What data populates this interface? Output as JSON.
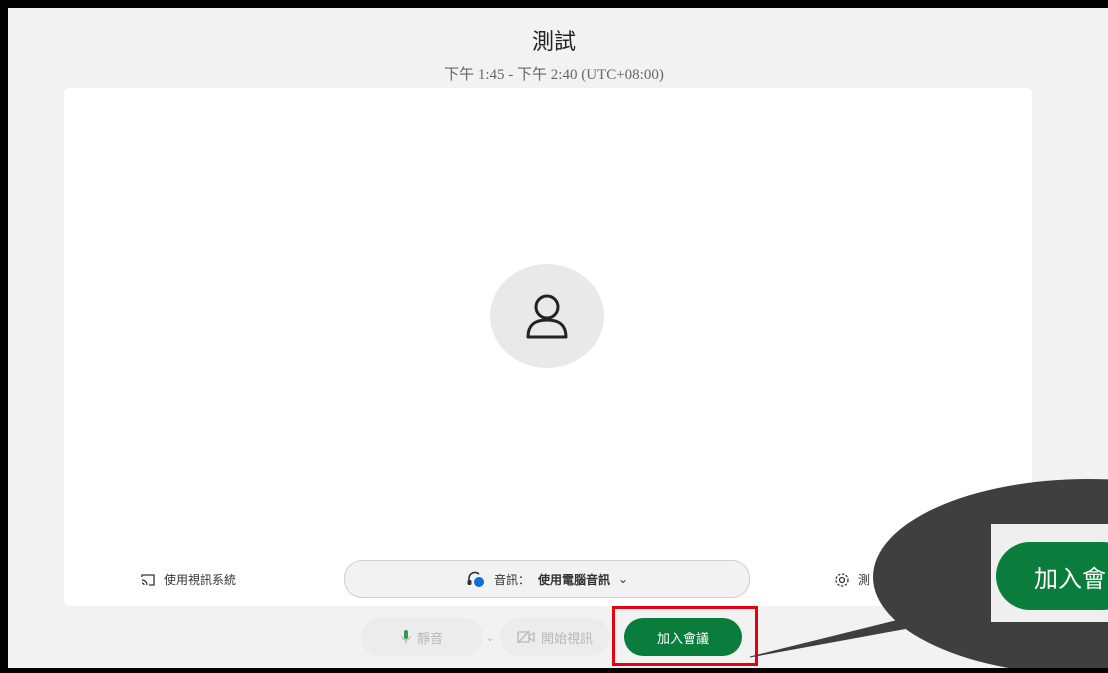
{
  "meeting": {
    "title": "測試",
    "time_range": "下午 1:45 - 下午 2:40 (UTC+08:00)"
  },
  "controls": {
    "video_system_label": "使用視訊系統",
    "audio_label": "音訊：",
    "audio_value": "使用電腦音訊",
    "settings_label": "測",
    "mute_label": "靜音",
    "video_label": "開始視訊",
    "join_label": "加入會議"
  },
  "callout": {
    "zoom_label": "加入會"
  },
  "colors": {
    "join_green": "#0a7c3c",
    "highlight_red": "#e60012",
    "callout_gray": "#3f3f3f"
  }
}
